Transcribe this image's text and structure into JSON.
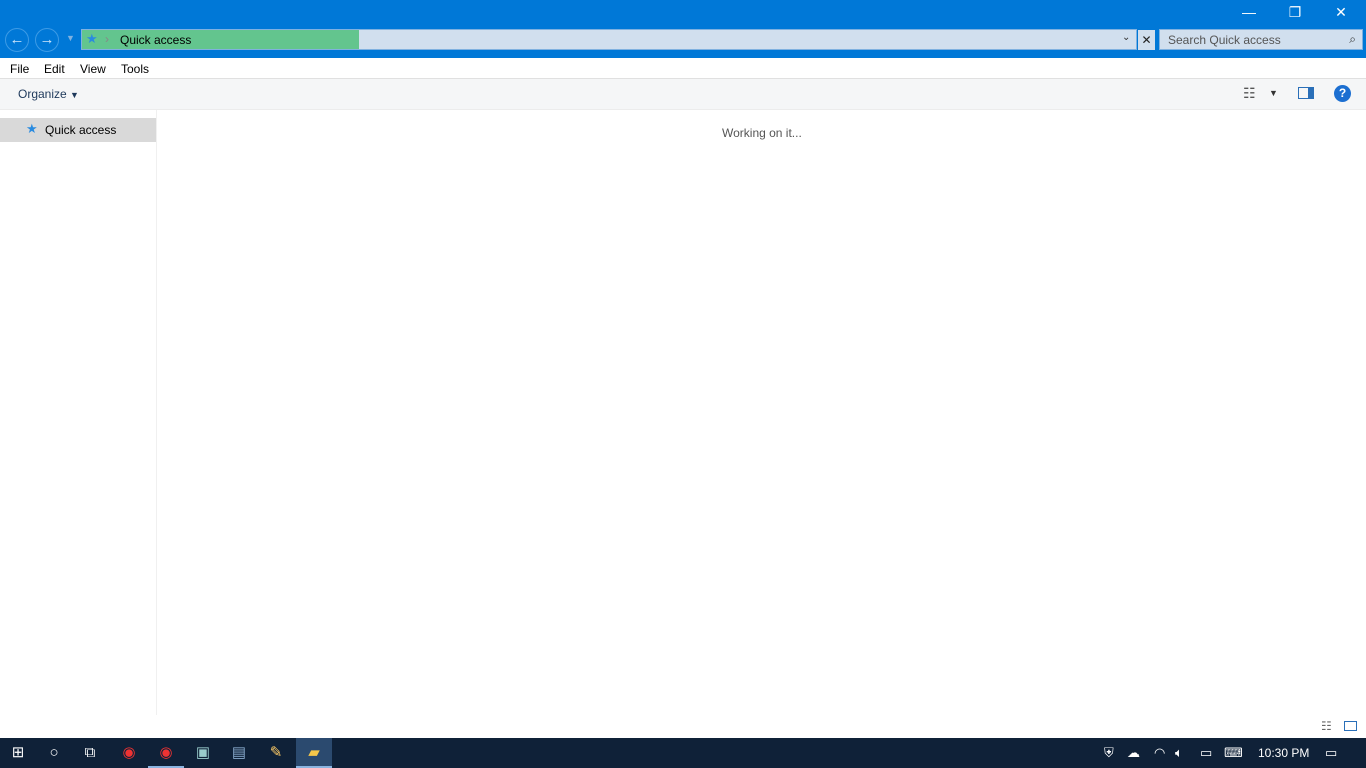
{
  "window": {
    "minimize": "—",
    "restore": "❐",
    "close": "✕"
  },
  "address": {
    "path": "Quick access",
    "separator": "›",
    "search_placeholder": "Search Quick access"
  },
  "menu": [
    "File",
    "Edit",
    "View",
    "Tools"
  ],
  "toolbar": {
    "organize": "Organize"
  },
  "sidebar": {
    "items": [
      {
        "label": "Quick access"
      }
    ]
  },
  "content": {
    "status": "Working on it..."
  },
  "taskbar": {
    "time": "10:30 PM"
  },
  "colors": {
    "accent": "#0078d7",
    "progress": "#63c58e",
    "taskbar": "#0f2138"
  }
}
